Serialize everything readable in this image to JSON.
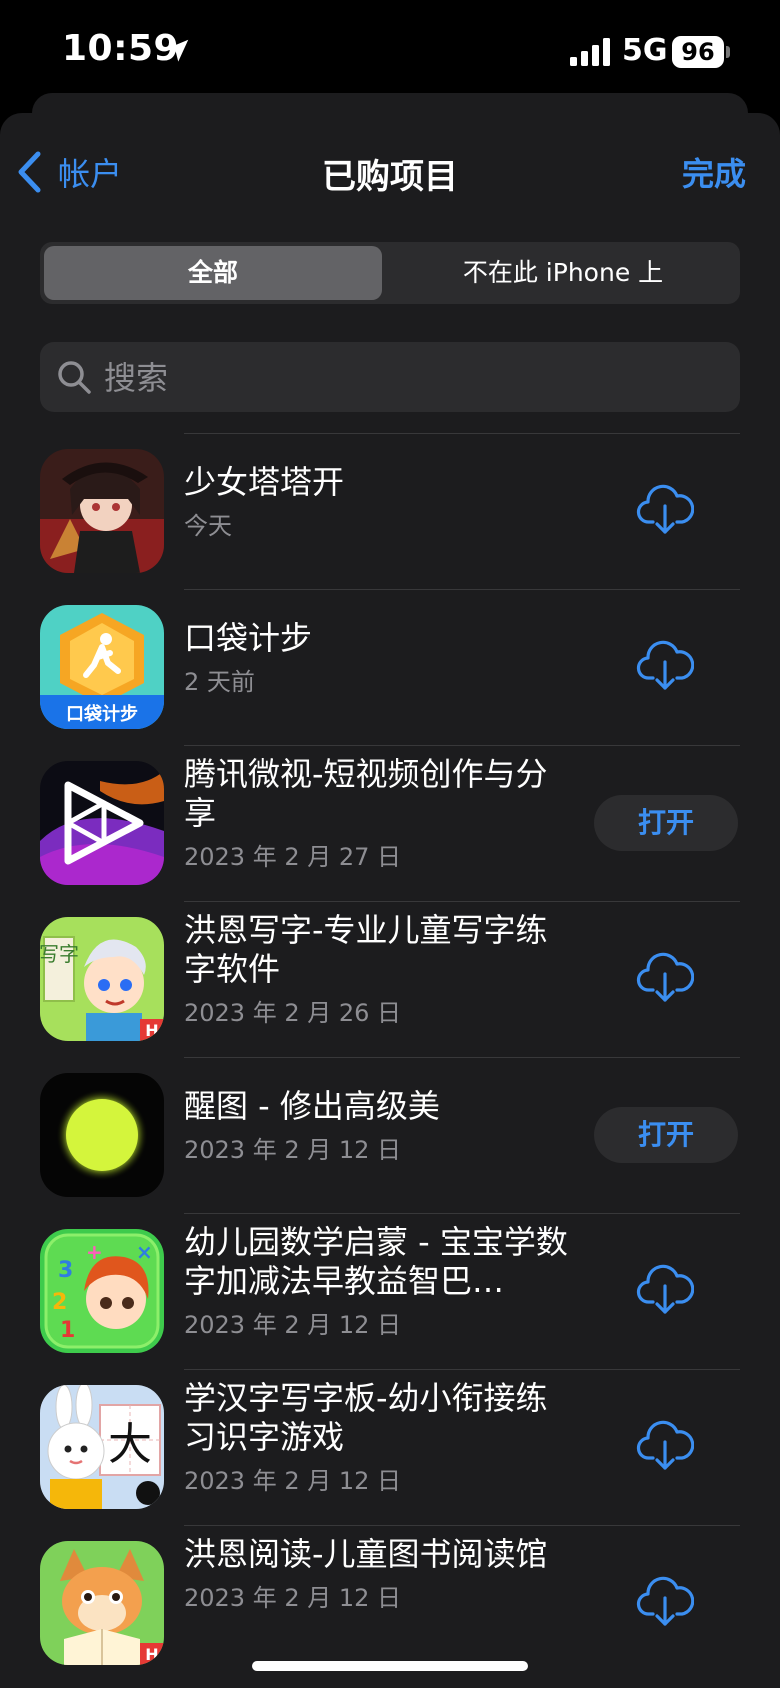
{
  "status_bar": {
    "time": "10:59",
    "network": "5G",
    "battery": "96"
  },
  "nav": {
    "back_label": "帐户",
    "title": "已购项目",
    "done_label": "完成"
  },
  "segments": {
    "all": "全部",
    "not_on_device": "不在此 iPhone 上"
  },
  "search": {
    "placeholder": "搜索"
  },
  "apps": [
    {
      "name": "少女塔塔开",
      "date": "今天",
      "action": "download",
      "action_label": ""
    },
    {
      "name": "口袋计步",
      "date": "2 天前",
      "action": "download",
      "action_label": "",
      "icon_text": "口袋计步"
    },
    {
      "name": "腾讯微视-短视频创作与分享",
      "date": "2023 年 2 月 27 日",
      "action": "open",
      "action_label": "打开"
    },
    {
      "name": "洪恩写字-专业儿童写字练字软件",
      "date": "2023 年 2 月 26 日",
      "action": "download",
      "action_label": "",
      "icon_text": "写字"
    },
    {
      "name": "醒图 - 修出高级美",
      "date": "2023 年 2 月 12 日",
      "action": "open",
      "action_label": "打开"
    },
    {
      "name": "幼儿园数学启蒙 - 宝宝学数字加减法早教益智巴…",
      "date": "2023 年 2 月 12 日",
      "action": "download",
      "action_label": ""
    },
    {
      "name": "学汉字写字板-幼小衔接练习识字游戏",
      "date": "2023 年 2 月 12 日",
      "action": "download",
      "action_label": "",
      "icon_text": "大"
    },
    {
      "name": "洪恩阅读-儿童图书阅读馆",
      "date": "2023 年 2 月 12 日",
      "action": "download",
      "action_label": ""
    }
  ],
  "colors": {
    "accent": "#3b8ef0",
    "background": "#1c1c1e",
    "secondary_text": "#8e8e93"
  }
}
